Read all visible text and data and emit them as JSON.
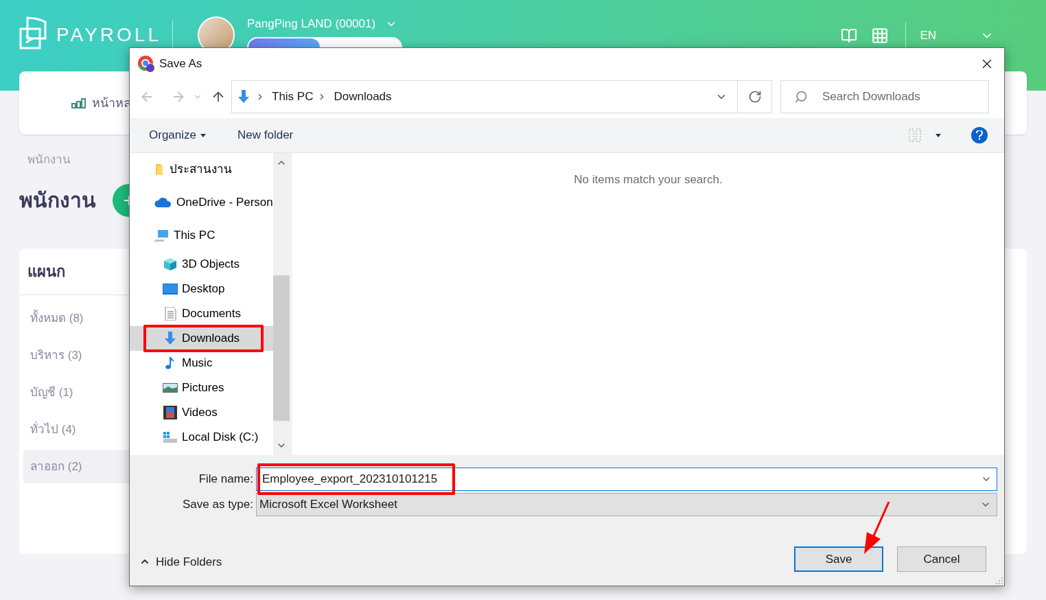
{
  "app": {
    "logo": "PAYROLL",
    "company": {
      "name": "PangPing LAND (00001)"
    },
    "language": "EN",
    "nav": {
      "label": "หน้าหล"
    },
    "breadcrumb": "พนักงาน",
    "title": "พนักงาน",
    "add_button": "+",
    "departments": {
      "title": "แผนก",
      "items": [
        {
          "label": "ทั้งหมด (8)",
          "selected": false
        },
        {
          "label": "บริหาร (3)",
          "selected": false
        },
        {
          "label": "บัญชี (1)",
          "selected": false
        },
        {
          "label": "ทั่วไป (4)",
          "selected": false
        },
        {
          "label": "ลาออก (2)",
          "selected": true
        }
      ]
    }
  },
  "dialog": {
    "title": "Save As",
    "breadcrumb": [
      "This PC",
      "Downloads"
    ],
    "search": {
      "placeholder": "Search Downloads"
    },
    "toolbar": [
      "Organize",
      "New folder"
    ],
    "nav_items": [
      {
        "label": "ประสานงาน",
        "kind": "folder",
        "selected": false
      },
      {
        "label": "OneDrive - Person",
        "kind": "cloud",
        "selected": false
      },
      {
        "label": "This PC",
        "kind": "pc",
        "selected": false,
        "children": [
          {
            "label": "3D Objects",
            "kind": "cube",
            "selected": false
          },
          {
            "label": "Desktop",
            "kind": "desktop",
            "selected": false
          },
          {
            "label": "Documents",
            "kind": "document",
            "selected": false
          },
          {
            "label": "Downloads",
            "kind": "download",
            "selected": true
          },
          {
            "label": "Music",
            "kind": "music",
            "selected": false
          },
          {
            "label": "Pictures",
            "kind": "picture",
            "selected": false
          },
          {
            "label": "Videos",
            "kind": "video",
            "selected": false
          },
          {
            "label": "Local Disk (C:)",
            "kind": "disk",
            "selected": false
          }
        ]
      }
    ],
    "empty_message": "No items match your search.",
    "file_name": {
      "label": "File name:",
      "value": "Employee_export_202310101215"
    },
    "save_type": {
      "label": "Save as type:",
      "value": "Microsoft Excel Worksheet"
    },
    "hide_folders": "Hide Folders",
    "buttons": [
      {
        "label": "Save",
        "kind": "primary"
      },
      {
        "label": "Cancel",
        "kind": "secondary"
      }
    ]
  }
}
